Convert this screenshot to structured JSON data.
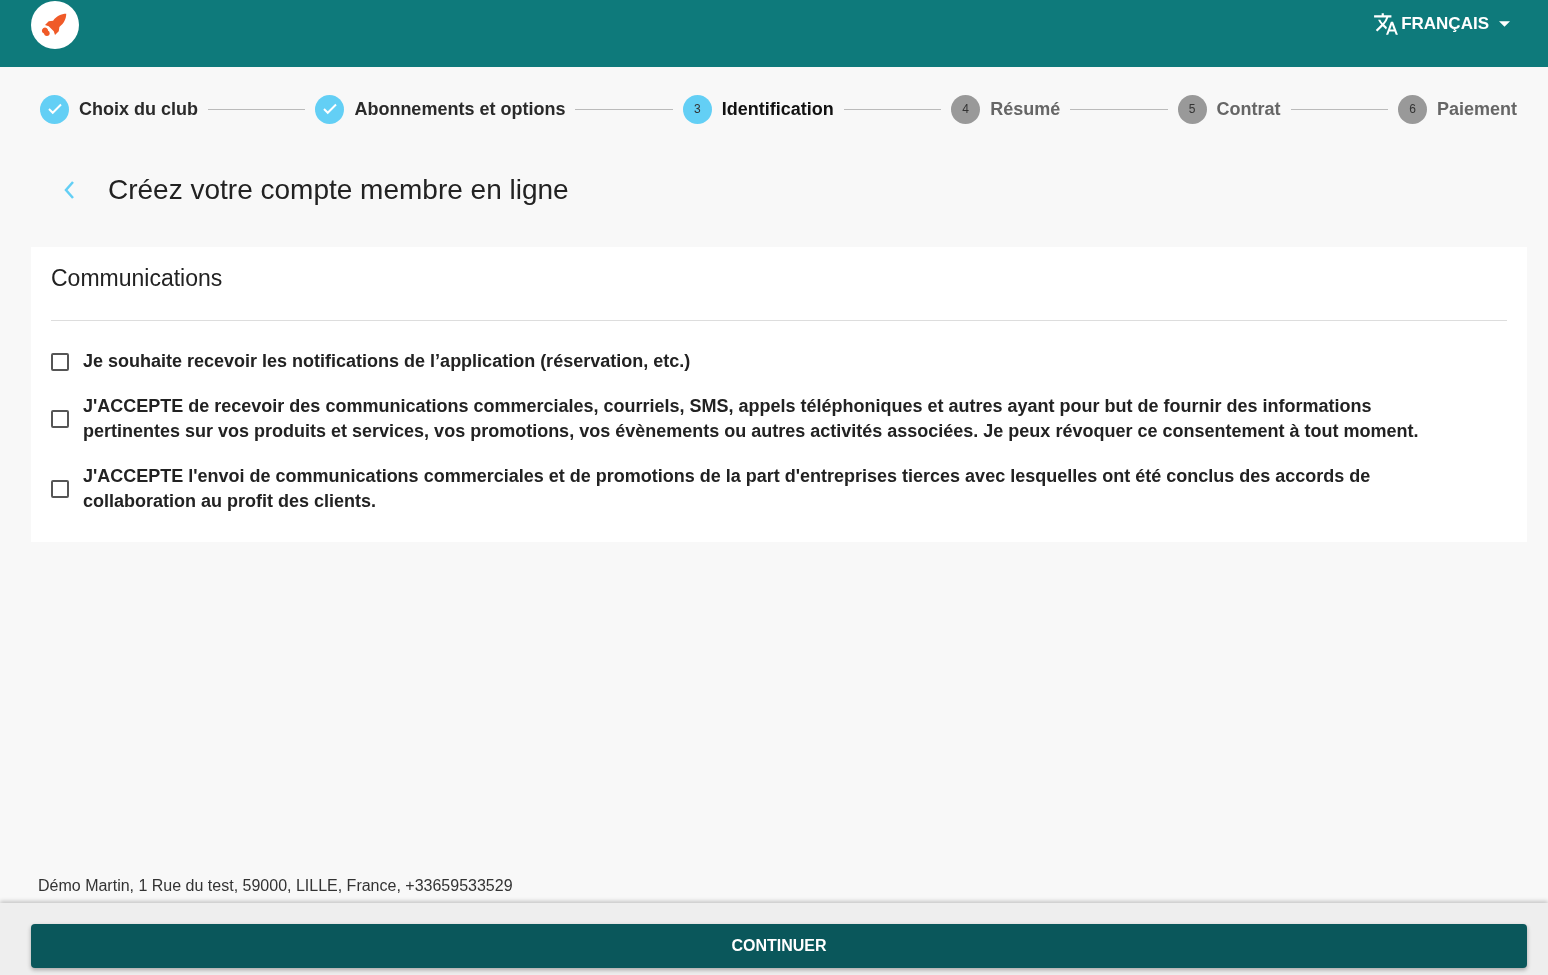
{
  "header": {
    "language": "FRANÇAIS"
  },
  "steps": [
    {
      "label": "Choix du club",
      "completed": true,
      "selected": false
    },
    {
      "label": "Abonnements et options",
      "completed": true,
      "selected": false
    },
    {
      "label": "Identification",
      "number": "3",
      "completed": false,
      "selected": true
    },
    {
      "label": "Résumé",
      "number": "4",
      "completed": false,
      "selected": false
    },
    {
      "label": "Contrat",
      "number": "5",
      "completed": false,
      "selected": false
    },
    {
      "label": "Paiement",
      "number": "6",
      "completed": false,
      "selected": false
    }
  ],
  "page_title": "Créez votre compte membre en ligne",
  "card": {
    "title": "Communications",
    "options": [
      {
        "label": "Je souhaite recevoir les notifications de l’application (réservation, etc.)",
        "checked": false
      },
      {
        "label": "J'ACCEPTE de recevoir des communications commerciales, courriels, SMS, appels téléphoniques et autres ayant pour but de fournir des informations pertinentes sur vos produits et services, vos promotions, vos évènements ou autres activités associées. Je peux révoquer ce consentement à tout moment.",
        "checked": false
      },
      {
        "label": "J'ACCEPTE l'envoi de communications commerciales et de promotions de la part d'entreprises tierces avec lesquelles ont été conclus des accords de collaboration au profit des clients.",
        "checked": false
      }
    ]
  },
  "footer": {
    "address": "Démo Martin, 1 Rue du test, 59000, LILLE, France, +33659533529",
    "button": "CONTINUER"
  }
}
